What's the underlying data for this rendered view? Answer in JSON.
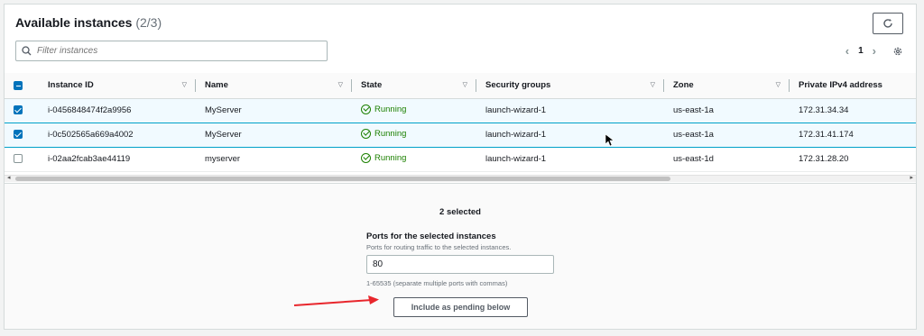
{
  "header": {
    "title": "Available instances",
    "count": "(2/3)"
  },
  "search": {
    "placeholder": "Filter instances"
  },
  "pagination": {
    "page": "1"
  },
  "columns": [
    "Instance ID",
    "Name",
    "State",
    "Security groups",
    "Zone",
    "Private IPv4 address"
  ],
  "rows": [
    {
      "id": "i-0456848474f2a9956",
      "name": "MyServer",
      "state": "Running",
      "sg": "launch-wizard-1",
      "zone": "us-east-1a",
      "ip": "172.31.34.34",
      "checked": true
    },
    {
      "id": "i-0c502565a669a4002",
      "name": "MyServer",
      "state": "Running",
      "sg": "launch-wizard-1",
      "zone": "us-east-1a",
      "ip": "172.31.41.174",
      "checked": true
    },
    {
      "id": "i-02aa2fcab3ae44119",
      "name": "myserver",
      "state": "Running",
      "sg": "launch-wizard-1",
      "zone": "us-east-1d",
      "ip": "172.31.28.20",
      "checked": false
    }
  ],
  "selection": {
    "summary": "2 selected",
    "ports_label": "Ports for the selected instances",
    "ports_description": "Ports for routing traffic to the selected instances.",
    "ports_value": "80",
    "ports_hint": "1-65535 (separate multiple ports with commas)",
    "include_button": "Include as pending below"
  },
  "colors": {
    "accent": "#0073bb",
    "running": "#1d8102",
    "arrow": "#e8262c"
  },
  "icons": [
    "refresh-icon",
    "search-icon",
    "chevron-left-icon",
    "chevron-right-icon",
    "settings-icon",
    "status-running-icon",
    "sort-filter-icon"
  ]
}
